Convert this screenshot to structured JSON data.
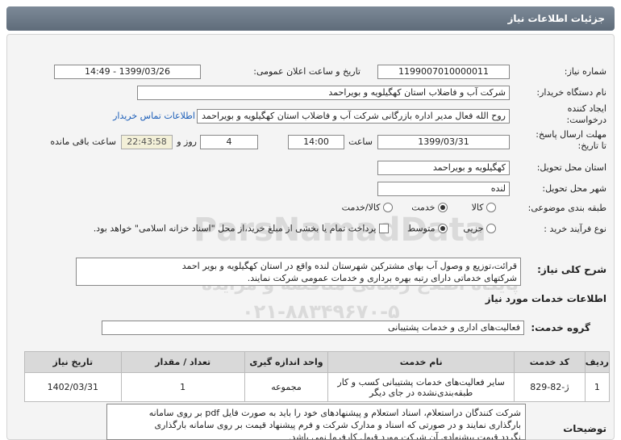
{
  "header": {
    "title": "جزئیات اطلاعات نیاز"
  },
  "fields": {
    "need_number_label": "شماره نیاز:",
    "need_number": "1199007010000011",
    "announce_label": "تاریخ و ساعت اعلان عمومی:",
    "announce_value": "1399/03/26 - 14:49",
    "buyer_label": "نام دستگاه خریدار:",
    "buyer_value": "شرکت آب و فاضلاب استان کهگیلویه و بویراحمد",
    "creator_label_1": "ایجاد کننده",
    "creator_label_2": "درخواست:",
    "creator_value": "روح الله فعال مدیر اداره بازرگانی شرکت آب و فاضلاب استان کهگیلویه و بویراحمد",
    "buyer_contact_link": "اطلاعات تماس خریدار",
    "deadline_label_1": "مهلت ارسال پاسخ:",
    "deadline_label_2": "تا تاریخ:",
    "deadline_date": "1399/03/31",
    "time_label": "ساعت",
    "deadline_time": "14:00",
    "days_value": "4",
    "days_label": "روز و",
    "remaining_timer": "22:43:58",
    "remaining_label": "ساعت باقی مانده",
    "province_label": "استان محل تحویل:",
    "province_value": "کهگیلویه و بویراحمد",
    "city_label": "شهر محل تحویل:",
    "city_value": "لنده",
    "category_label": "طبقه بندی موضوعی:",
    "category_options": [
      "کالا",
      "خدمت",
      "کالا/خدمت"
    ],
    "purchase_type_label": "نوع فرآیند خرید :",
    "purchase_options": [
      "جزیی",
      "متوسط"
    ],
    "payment_note": "پرداخت تمام یا بخشی از مبلغ خرید،از محل \"اسناد خزانه اسلامی\" خواهد بود."
  },
  "description": {
    "label": "شرح کلی نیاز:",
    "line1": "قرائت،توزیع و وصول آب بهای مشترکین شهرستان لنده واقع در استان کهگیلویه و بویر احمد",
    "line2": "شرکتهای خدماتی دارای رتبه بهره برداری و خدمات عمومی شرکت نمایند."
  },
  "services_section": {
    "title": "اطلاعات خدمات مورد نیاز",
    "group_label": "گروه خدمت:",
    "group_value": "فعالیت‌های اداری و خدمات پشتیبانی"
  },
  "table": {
    "headers": [
      "ردیف",
      "کد خدمت",
      "نام خدمت",
      "واحد اندازه گیری",
      "تعداد / مقدار",
      "تاریخ نیاز"
    ],
    "rows": [
      {
        "index": "1",
        "code": "ژ-82-829",
        "name_line1": "سایر فعالیت‌های خدمات پشتیبانی کسب و کار",
        "name_line2": "طبقه‌بندی‌نشده در جای دیگر",
        "unit": "مجموعه",
        "qty": "1",
        "date": "1402/03/31"
      }
    ]
  },
  "notes": {
    "label": "توضیحات",
    "line1": "شرکت کنندگان دراستعلام، اسناد استعلام و پیشنهادهای خود را باید به صورت فایل pdf بر روی سامانه",
    "line2": "بارگذاری نمایند و در صورتی که اسناد و مدارک شرکت و فرم پیشنهاد قیمت بر روی سامانه بارگذاری",
    "line3": "نگردد قیمت پیشنهادی آن شرکت مورد قبول کارفرما نمی باشد."
  },
  "watermark": {
    "brand": "ParsNamadData",
    "line1": "پایگاه اطلاع رسانی مناقصه و مزایده",
    "phone": "۰۲۱-۸۸۳۴۹۶۷۰-۵"
  }
}
